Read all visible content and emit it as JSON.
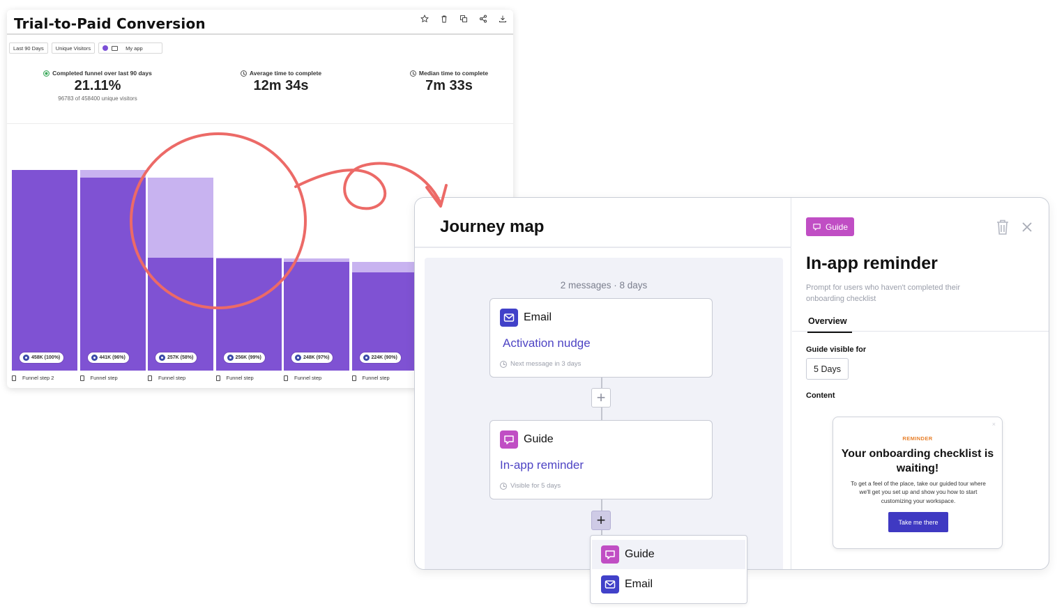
{
  "funnel": {
    "title": "Trial-to-Paid Conversion",
    "filters": {
      "period": "Last 90 Days",
      "metric": "Unique Visitors",
      "app": "My app"
    },
    "metrics": [
      {
        "label": "Completed funnel over last 90 days",
        "value": "21.11%",
        "sub": "96783 of 458400 unique visitors"
      },
      {
        "label": "Average time to complete",
        "value": "12m 34s"
      },
      {
        "label": "Median time to complete",
        "value": "7m 33s"
      }
    ],
    "colors": {
      "bar": "#7f52d3",
      "bar_dropoff": "#c8b3f0"
    }
  },
  "chart_data": {
    "type": "bar",
    "categories": [
      "Funnel step 2",
      "Funnel step",
      "Funnel step",
      "Funnel step",
      "Funnel step",
      "Funnel step"
    ],
    "series": [
      {
        "values": [
          458000,
          441000,
          257000,
          256000,
          248000,
          224000
        ]
      }
    ],
    "labels": [
      "458K (100%)",
      "441K (96%)",
      "257K (58%)",
      "256K (99%)",
      "248K (97%)",
      "224K (90%)"
    ],
    "ylim": [
      0,
      458000
    ],
    "legend": "none"
  },
  "journey": {
    "title": "Journey map",
    "summary": "2 messages · 8 days",
    "messages": [
      {
        "type": "Email",
        "name": "Activation nudge",
        "meta": "Next message in 3 days"
      },
      {
        "type": "Guide",
        "name": "In-app reminder",
        "meta": "Visible for 5 days"
      }
    ],
    "add_menu": [
      "Guide",
      "Email"
    ]
  },
  "panel": {
    "badge": "Guide",
    "title": "In-app reminder",
    "description": "Prompt for users who haven't completed their onboarding checklist",
    "tab": "Overview",
    "visible_label": "Guide visible for",
    "visible_value": "5 Days",
    "content_label": "Content",
    "preview": {
      "close": "×",
      "kicker": "REMINDER",
      "title": "Your onboarding checklist is waiting!",
      "body": "To get a feel of the place, take our guided tour where we'll get you set up and show you how to start customizing your workspace.",
      "button": "Take me there"
    }
  },
  "colors": {
    "annotation": "#ec6a67",
    "email": "#4141c9",
    "guide": "#c04ec4",
    "accent_text": "#4e44c4"
  }
}
